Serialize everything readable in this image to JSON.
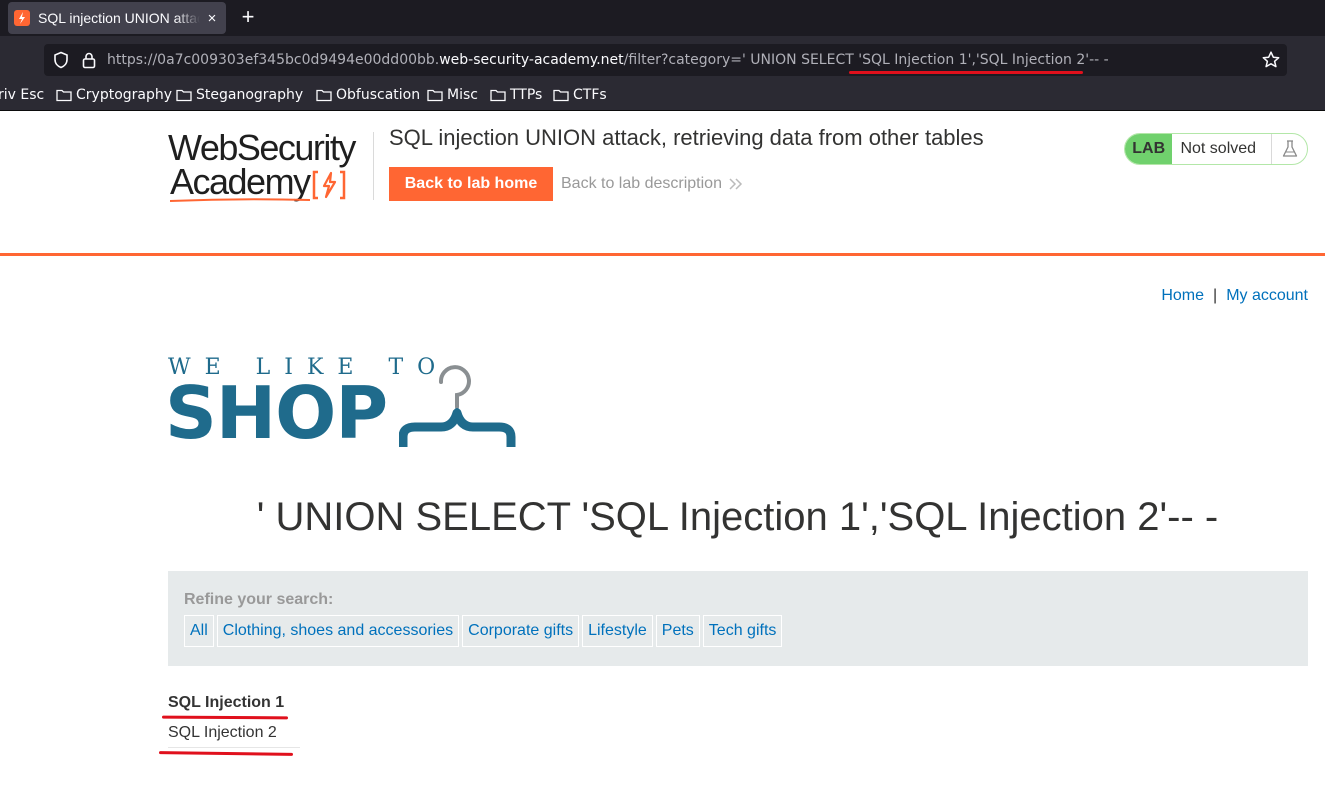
{
  "browser": {
    "tab_title": "SQL injection UNION attack, retrieving data from other tables",
    "tab_close": "×",
    "new_tab": "+",
    "url_prefix": "https://0a7c009303ef345bc0d9494e00dd00bb.",
    "url_domain": "web-security-academy.net",
    "url_rest": "/filter?category=' UNION SELECT 'SQL Injection 1','SQL Injection 2'-- -",
    "bookmarks": [
      "riv Esc",
      "Cryptography",
      "Steganography",
      "Obfuscation",
      "Misc",
      "TTPs",
      "CTFs"
    ],
    "annotation_color": "#e0101c"
  },
  "lab": {
    "logo_line1": "WebSecurity",
    "logo_line2": "Academy",
    "title": "SQL injection UNION attack, retrieving data from other tables",
    "back_home": "Back to lab home",
    "back_description": "Back to lab description",
    "badge": "LAB",
    "status": "Not solved",
    "accent": "#ff6633",
    "status_color": "#70d16d"
  },
  "shop": {
    "nav": {
      "home": "Home",
      "separator": "|",
      "account": "My account"
    },
    "logo_small": "WE LIKE TO",
    "logo_big": "SHOP",
    "brand_color": "#1f6b8c",
    "heading": "' UNION SELECT 'SQL Injection 1','SQL Injection 2'-- -",
    "refine_label": "Refine your search:",
    "filters": [
      "All",
      "Clothing, shoes and accessories",
      "Corporate gifts",
      "Lifestyle",
      "Pets",
      "Tech gifts"
    ],
    "results": [
      "SQL Injection 1",
      "SQL Injection 2"
    ]
  }
}
